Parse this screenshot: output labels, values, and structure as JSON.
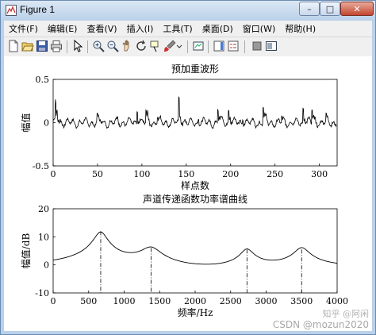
{
  "window": {
    "title": "Figure 1",
    "minimize_glyph": "–",
    "maximize_glyph": "□",
    "close_glyph": "✕",
    "icon": "matlab-figure-icon"
  },
  "menu": [
    {
      "label": "文件(F)",
      "key": "file"
    },
    {
      "label": "编辑(E)",
      "key": "edit"
    },
    {
      "label": "查看(V)",
      "key": "view"
    },
    {
      "label": "插入(I)",
      "key": "insert"
    },
    {
      "label": "工具(T)",
      "key": "tools"
    },
    {
      "label": "桌面(D)",
      "key": "desktop"
    },
    {
      "label": "窗口(W)",
      "key": "window"
    },
    {
      "label": "帮助(H)",
      "key": "help"
    }
  ],
  "toolbar": [
    "new-figure-icon",
    "open-file-icon",
    "save-icon",
    "print-icon",
    "pointer-icon",
    "zoom-in-icon",
    "zoom-out-icon",
    "pan-icon",
    "rotate-3d-icon",
    "data-cursor-icon",
    "brush-icon",
    "link-plot-icon",
    "colorbar-icon",
    "legend-icon",
    "hide-plot-tools-icon",
    "show-plot-tools-icon"
  ],
  "watermark": "CSDN @mozun2020",
  "watermark_logo": "知乎 @阿闲",
  "chart_data": [
    {
      "type": "line",
      "title": "预加重波形",
      "xlabel": "样点数",
      "ylabel": "幅值",
      "xlim": [
        0,
        320
      ],
      "ylim": [
        -0.5,
        0.5
      ],
      "xticks": [
        0,
        50,
        100,
        150,
        200,
        250,
        300
      ],
      "yticks": [
        -0.5,
        0,
        0.5
      ],
      "ytick_labels": [
        "-0.5",
        "0",
        "0.5"
      ],
      "pulses": [
        {
          "x": 2,
          "peak": 0.34,
          "trough": -0.5
        },
        {
          "x": 49,
          "peak": 0.13,
          "trough": -0.1
        },
        {
          "x": 72,
          "peak": 0.06,
          "trough": -0.04
        },
        {
          "x": 94,
          "peak": 0.25,
          "trough": -0.22
        },
        {
          "x": 104,
          "peak": 0.19,
          "trough": -0.28
        },
        {
          "x": 117,
          "peak": 0.12,
          "trough": -0.07
        },
        {
          "x": 141,
          "peak": 0.42,
          "trough": -0.28
        },
        {
          "x": 163,
          "peak": 0.09,
          "trough": -0.06
        },
        {
          "x": 185,
          "peak": 0.25,
          "trough": -0.24
        },
        {
          "x": 197,
          "peak": 0.22,
          "trough": -0.27
        },
        {
          "x": 213,
          "peak": 0.1,
          "trough": -0.07
        },
        {
          "x": 236,
          "peak": 0.29,
          "trough": -0.2
        },
        {
          "x": 257,
          "peak": 0.1,
          "trough": -0.07
        },
        {
          "x": 281,
          "peak": 0.27,
          "trough": -0.24
        },
        {
          "x": 291,
          "peak": 0.23,
          "trough": -0.26
        },
        {
          "x": 307,
          "peak": 0.1,
          "trough": -0.08
        }
      ]
    },
    {
      "type": "line",
      "title": "声道传递函数功率谱曲线",
      "xlabel": "频率/Hz",
      "ylabel": "幅值/dB",
      "xlim": [
        0,
        4000
      ],
      "ylim": [
        -10,
        20
      ],
      "xticks": [
        0,
        500,
        1000,
        1500,
        2000,
        2500,
        3000,
        3500,
        4000
      ],
      "yticks": [
        -10,
        0,
        10,
        20
      ],
      "formants": [
        {
          "f": 670,
          "db": 12,
          "bw": 175
        },
        {
          "f": 1380,
          "db": 6,
          "bw": 260
        },
        {
          "f": 2730,
          "db": 5.5,
          "bw": 170
        },
        {
          "f": 3500,
          "db": 5.5,
          "bw": 200
        }
      ],
      "baseline_db": -5
    }
  ]
}
